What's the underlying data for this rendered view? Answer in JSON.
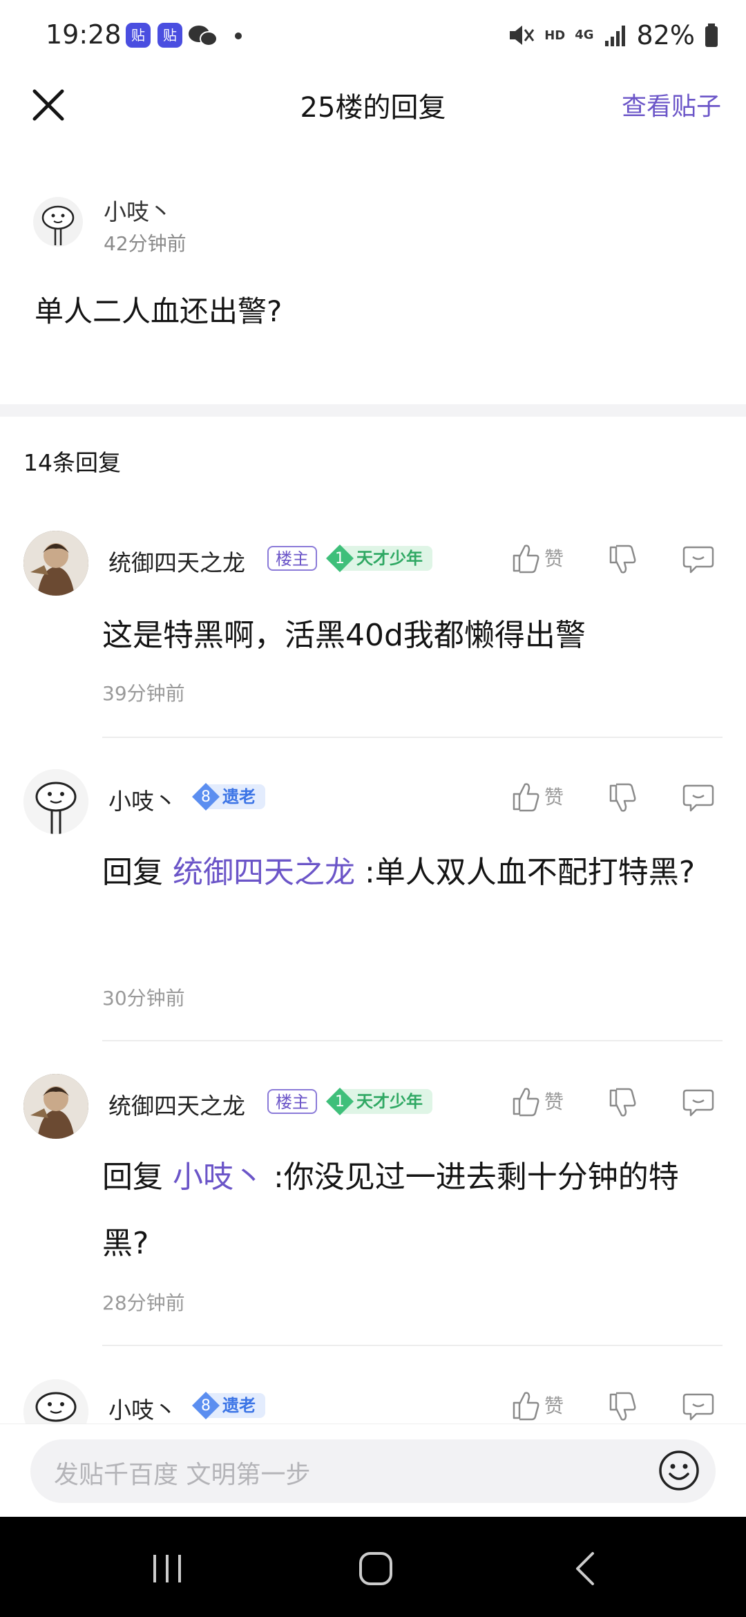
{
  "status_bar": {
    "time": "19:28",
    "app_icon_label": "贴",
    "network": "HD",
    "network_type": "4G",
    "battery": "82%"
  },
  "nav": {
    "title": "25楼的回复",
    "view_post": "查看贴子"
  },
  "post": {
    "user": "小吱丶",
    "time": "42分钟前",
    "text": "单人二人血还出警?"
  },
  "replies_count": "14条回复",
  "actions": {
    "like": "赞"
  },
  "replies": [
    {
      "user": "统御四天之龙",
      "floor_badge": "楼主",
      "level": "1",
      "level_title": "天才少年",
      "text": "这是特黑啊，活黑40d我都懒得出警",
      "time": "39分钟前"
    },
    {
      "user": "小吱丶",
      "level": "8",
      "level_title": "遗老",
      "reply_prefix": "回复 ",
      "mention": "统御四天之龙",
      "text": " :单人双人血不配打特黑?",
      "time": "30分钟前"
    },
    {
      "user": "统御四天之龙",
      "floor_badge": "楼主",
      "level": "1",
      "level_title": "天才少年",
      "reply_prefix": "回复 ",
      "mention": "小吱丶",
      "text": " :你没见过一进去剩十分钟的特黑?",
      "time": "28分钟前"
    },
    {
      "user": "小吱丶",
      "level": "8",
      "level_title": "遗老"
    }
  ],
  "input": {
    "placeholder": "发贴千百度 文明第一步"
  },
  "colors": {
    "accent": "#6b55c8",
    "level_green": "#3fbf7a",
    "level_blue": "#5b8ef0"
  }
}
